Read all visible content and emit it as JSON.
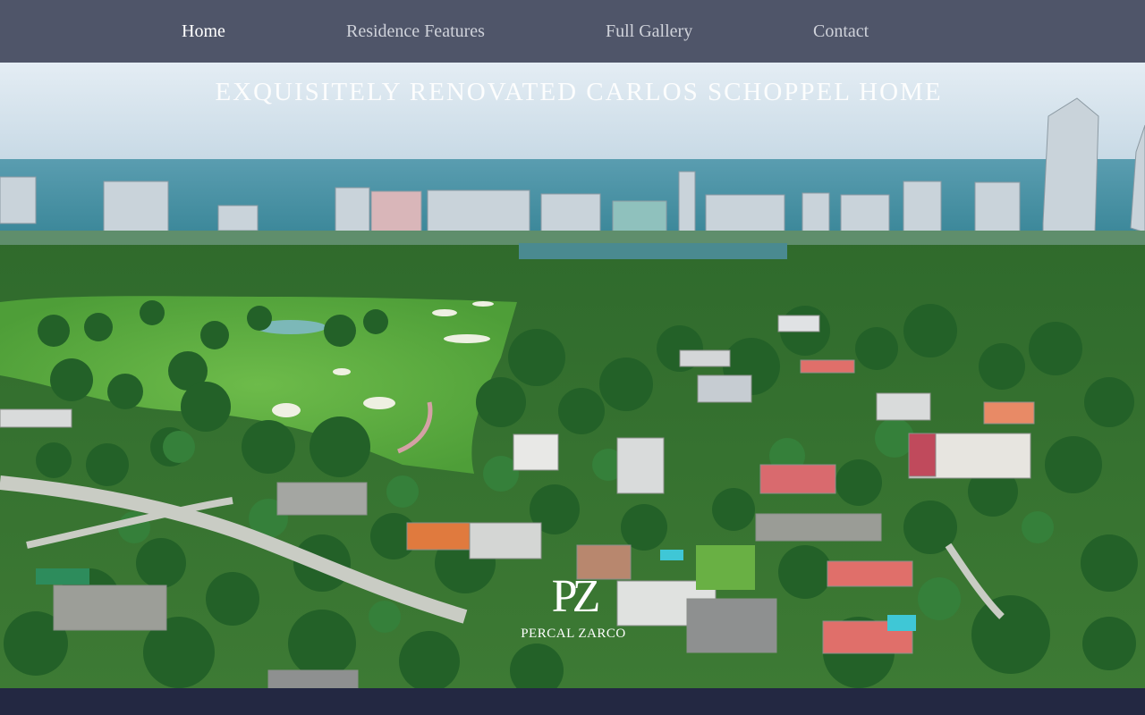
{
  "nav": {
    "items": [
      {
        "label": "Home",
        "active": true
      },
      {
        "label": "Residence Features",
        "active": false
      },
      {
        "label": "Full Gallery",
        "active": false
      },
      {
        "label": "Contact",
        "active": false
      }
    ]
  },
  "hero": {
    "title": "EXQUISITELY RENOVATED CARLOS SCHOPPEL HOME",
    "image_description_icon": "aerial-photo"
  },
  "logo": {
    "mark": "PZ",
    "text": "PERCAL ZARCO"
  },
  "colors": {
    "nav_bg": "#4f5569",
    "nav_text": "#cfd2da",
    "nav_active": "#ffffff",
    "footer_bg": "#232842"
  }
}
